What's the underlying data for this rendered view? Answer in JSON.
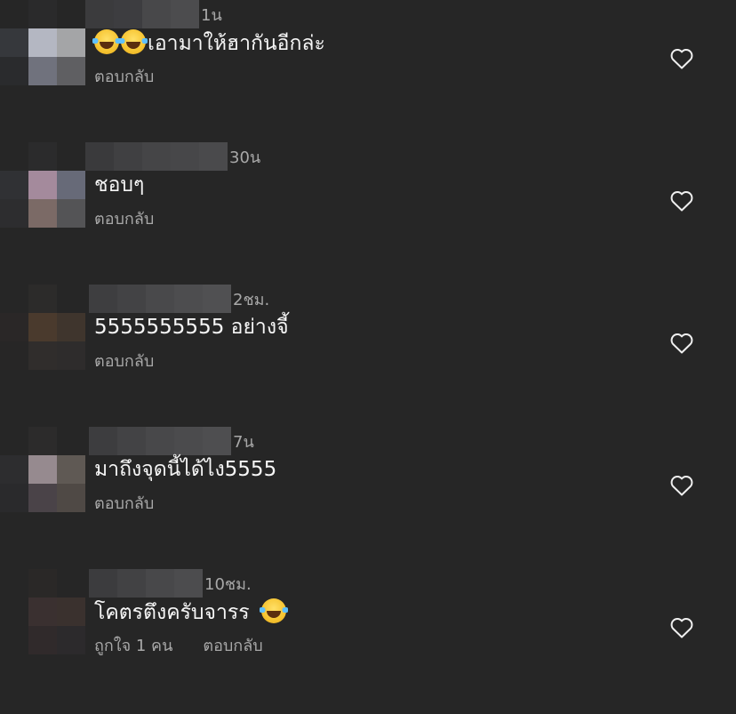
{
  "comments": [
    {
      "time": "1น",
      "emojis": 2,
      "text": "เอามาให้ฮากันอีกล่ะ",
      "reply_label": "ตอบกลับ",
      "like_text": "",
      "avatar_colors": [
        "#262626",
        "#2a2a2b",
        "#262626",
        "#36383c",
        "#b4b7c2",
        "#a4a5a7",
        "#2a2b2d",
        "#70727d",
        "#5f5f62"
      ],
      "name_colors": [
        "#3b3b3d",
        "#3d3d40",
        "#48484a",
        "#4c4c4e"
      ]
    },
    {
      "time": "30น",
      "emojis": 0,
      "text": "ชอบๆ",
      "reply_label": "ตอบกลับ",
      "like_text": "",
      "avatar_colors": [
        "#262626",
        "#2b2b2c",
        "#262626",
        "#303134",
        "#a48a9c",
        "#676a78",
        "#2d2d2f",
        "#7b6a66",
        "#545456"
      ],
      "name_colors": [
        "#3a3a3c",
        "#404042",
        "#454547",
        "#474749",
        "#4a4a4c"
      ]
    },
    {
      "time": "2ชม.",
      "emojis": 0,
      "text": "5555555555 อย่างจี้",
      "reply_label": "ตอบกลับ",
      "like_text": "",
      "avatar_colors": [
        "#262626",
        "#2c2b2a",
        "#262626",
        "#2a2727",
        "#4a3a2d",
        "#3f352d",
        "#272626",
        "#302d2c",
        "#2e2c2c"
      ],
      "name_colors": [
        "#3e3e40",
        "#434345",
        "#49494b",
        "#4d4d4f",
        "#505052"
      ],
      "name_start": 100
    },
    {
      "time": "7น",
      "emojis": 0,
      "text": "มาถึงจุดนี้ได้ไง5555",
      "reply_label": "ตอบกลับ",
      "like_text": "",
      "avatar_colors": [
        "#262626",
        "#2c2b2b",
        "#262626",
        "#2d2d2f",
        "#968a8f",
        "#5f5954",
        "#2a2a2c",
        "#4a4348",
        "#4f4945"
      ],
      "name_colors": [
        "#3d3d3f",
        "#434345",
        "#48484a",
        "#4b4b4d",
        "#4e4e50"
      ],
      "name_start": 100
    },
    {
      "time": "10ชม.",
      "emojis": 1,
      "text": "โคตรตึงครับจารร ",
      "emoji_after": true,
      "reply_label": "ตอบกลับ",
      "like_text": "ถูกใจ 1 คน",
      "avatar_colors": [
        "#262626",
        "#2a2827",
        "#262626",
        "#262626",
        "#3a3030",
        "#3a312e",
        "#262626",
        "#302a2b",
        "#2c2a2c"
      ],
      "name_colors": [
        "#3c3c3e",
        "#424244",
        "#48484a",
        "#4c4c4e"
      ],
      "name_start": 100
    }
  ],
  "icons": {
    "like": "heart-outline-icon",
    "emoji": "face-with-tears-of-joy-emoji"
  },
  "colors": {
    "background": "#262626",
    "primary_text": "#f5f5f5",
    "secondary_text": "#a8a8a8"
  }
}
